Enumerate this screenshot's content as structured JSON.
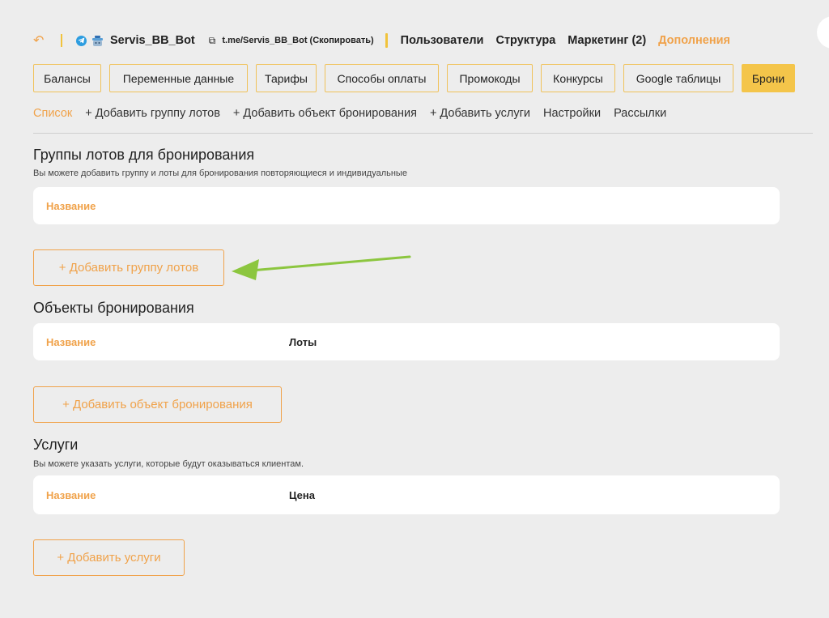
{
  "topbar": {
    "back_icon": "↶",
    "bot_name": "Servis_BB_Bot",
    "link_icon": "⧉",
    "bot_link": "t.me/Servis_BB_Bot (Скопировать)",
    "nav": [
      "Пользователи",
      "Структура",
      "Маркетинг (2)",
      "Дополнения"
    ],
    "active_nav": "Дополнения"
  },
  "tabs": [
    "Балансы",
    "Переменные данные",
    "Тарифы",
    "Способы оплаты",
    "Промокоды",
    "Конкурсы",
    "Google таблицы",
    "Брони"
  ],
  "active_tab": "Брони",
  "subnav": [
    "Список",
    "+ Добавить группу лотов",
    "+ Добавить объект бронирования",
    "+ Добавить услуги",
    "Настройки",
    "Рассылки"
  ],
  "active_subnav": "Список",
  "sections": {
    "groups": {
      "title": "Группы лотов для бронирования",
      "desc": "Вы можете добавить группу и лоты для бронирования повторяющиеся и индивидуальные",
      "col1": "Название",
      "button": "+ Добавить группу лотов"
    },
    "objects": {
      "title": "Объекты бронирования",
      "col1": "Название",
      "col2": "Лоты",
      "button": "+ Добавить объект бронирования"
    },
    "services": {
      "title": "Услуги",
      "desc": "Вы можете указать услуги, которые будут оказываться клиентам.",
      "col1": "Название",
      "col2": "Цена",
      "button": "+ Добавить услуги"
    }
  },
  "colors": {
    "accent": "#f0a24a",
    "tab_active": "#f4c54a",
    "tab_border": "#f0c25a",
    "arrow": "#8cc63f",
    "telegram": "#2d9de0",
    "background": "#ededed"
  }
}
